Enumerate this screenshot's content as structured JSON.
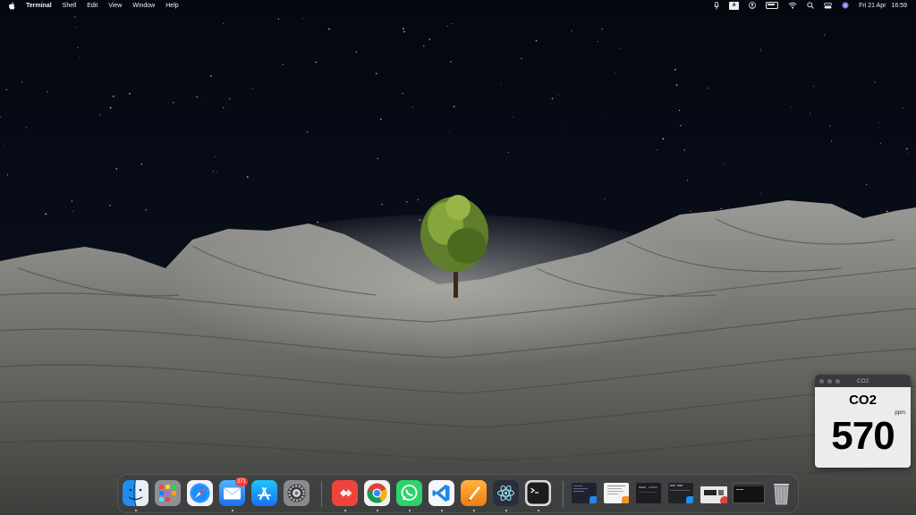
{
  "menubar": {
    "app_name": "Terminal",
    "menus": [
      "Shell",
      "Edit",
      "View",
      "Window",
      "Help"
    ],
    "keyboard_indicator": "A",
    "date": "Fri 21 Apr",
    "time": "16:59",
    "status_icons": [
      "mic-icon",
      "keyboard-input-icon",
      "user-icon",
      "battery-icon",
      "wifi-icon",
      "spotlight-search-icon",
      "control-center-icon",
      "siri-icon"
    ]
  },
  "co2_widget": {
    "window_title": "CO2",
    "label": "CO2",
    "value": "570",
    "unit": "ppm"
  },
  "dock": {
    "apps": [
      {
        "name": "Finder",
        "icon": "finder-icon",
        "running": true
      },
      {
        "name": "Launchpad",
        "icon": "launchpad-icon",
        "running": false
      },
      {
        "name": "Safari",
        "icon": "safari-icon",
        "running": false
      },
      {
        "name": "Mail",
        "icon": "mail-icon",
        "running": true,
        "badge": "371"
      },
      {
        "name": "App Store",
        "icon": "app-store-icon",
        "running": false
      },
      {
        "name": "System Settings",
        "icon": "system-settings-icon",
        "running": false
      },
      {
        "name": "AnyDesk",
        "icon": "anydesk-icon",
        "running": true
      },
      {
        "name": "Chrome",
        "icon": "chrome-icon",
        "running": true
      },
      {
        "name": "WhatsApp",
        "icon": "whatsapp-icon",
        "running": true
      },
      {
        "name": "VS Code",
        "icon": "vscode-icon",
        "running": true
      },
      {
        "name": "Pages",
        "icon": "pages-icon",
        "running": true
      },
      {
        "name": "Electron",
        "icon": "electron-icon",
        "running": true
      },
      {
        "name": "Terminal",
        "icon": "terminal-icon",
        "running": true
      }
    ],
    "minimized_windows": [
      "window-thumbnail-vscode",
      "window-thumbnail-pages",
      "window-thumbnail-dark",
      "window-thumbnail-finder",
      "window-thumbnail-chrome",
      "window-thumbnail-terminal"
    ],
    "trash": {
      "icon": "trash-icon"
    }
  },
  "colors": {
    "sky": "#070a14",
    "rock": "#8c8d88",
    "tree": "#6b8a2e",
    "badge": "#ff3b30"
  }
}
